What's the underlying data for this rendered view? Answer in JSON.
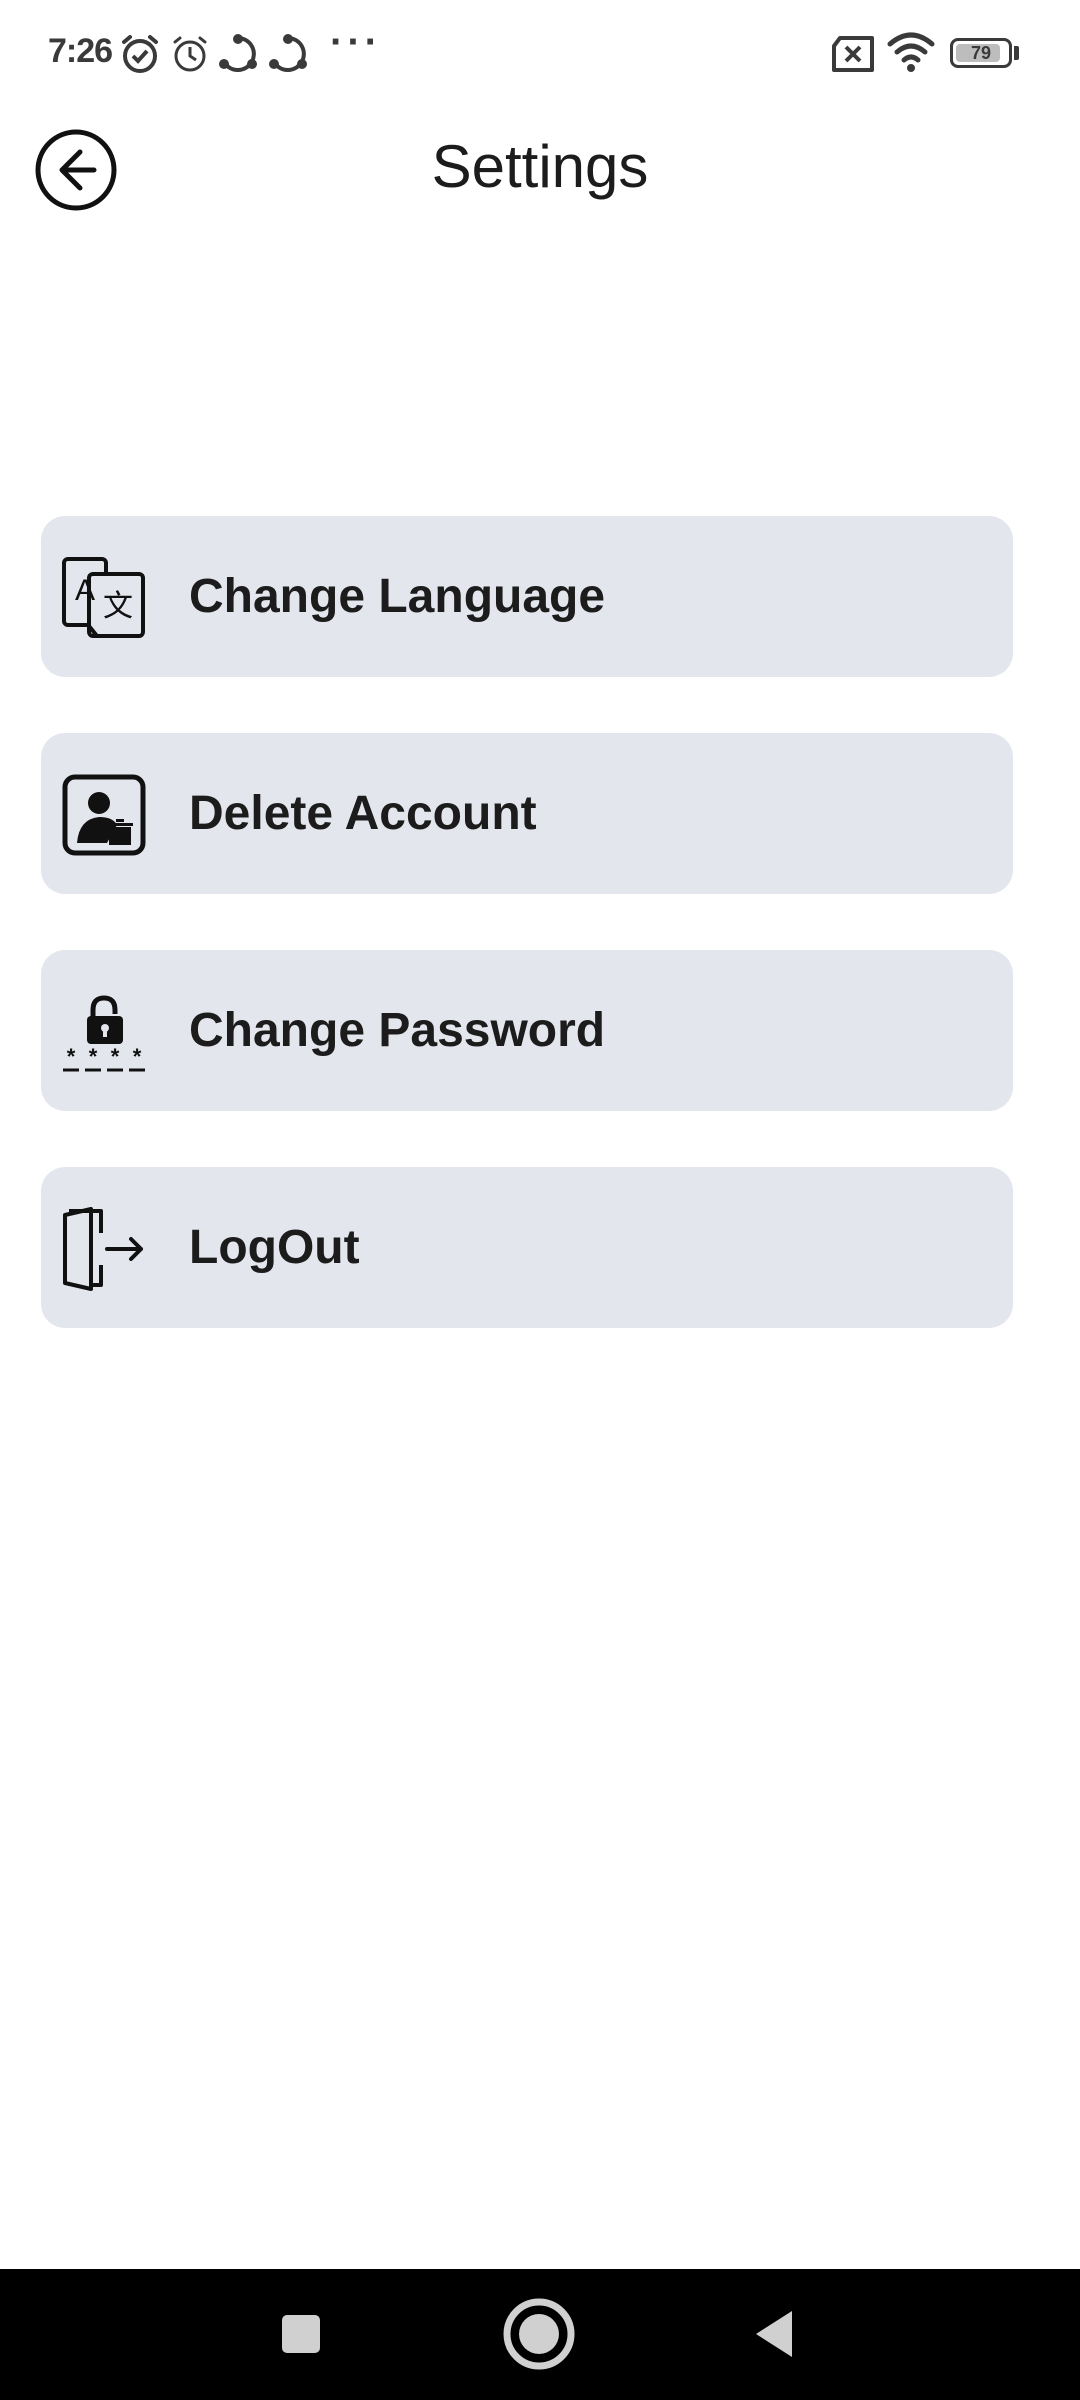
{
  "status_bar": {
    "time": "7:26",
    "dots": "···",
    "battery_level": "79"
  },
  "header": {
    "title": "Settings"
  },
  "settings": {
    "items": [
      {
        "label": "Change Language",
        "icon": "translate-icon"
      },
      {
        "label": "Delete Account",
        "icon": "delete-account-icon"
      },
      {
        "label": "Change Password",
        "icon": "password-lock-icon"
      },
      {
        "label": "LogOut",
        "icon": "logout-icon"
      }
    ]
  },
  "colors": {
    "item_background": "#e4e6ee",
    "text": "#1c1c1c",
    "nav_bar": "#000000"
  }
}
